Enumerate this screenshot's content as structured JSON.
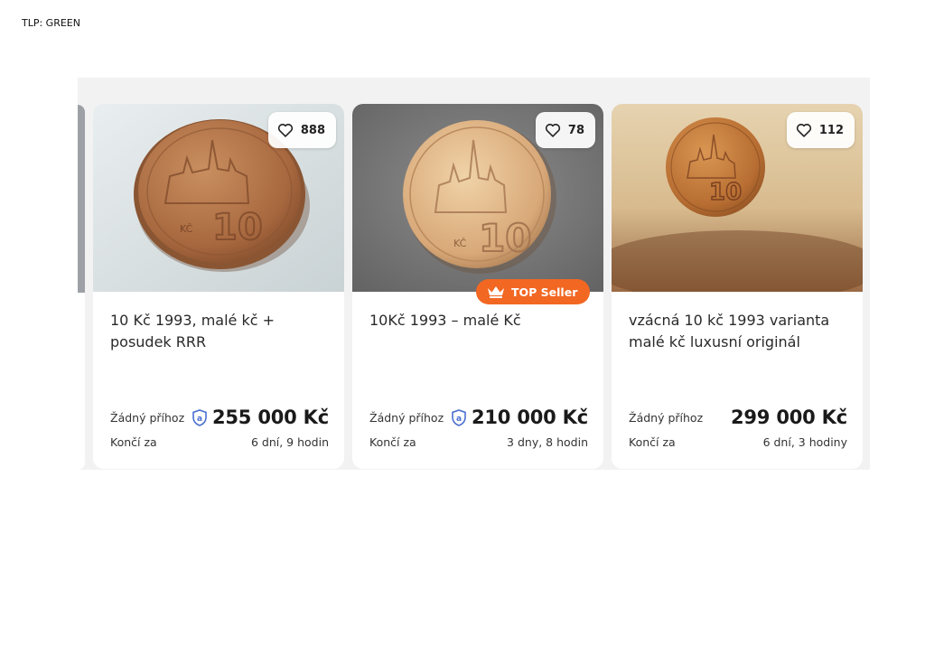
{
  "header": {
    "tlp": "TLP: GREEN"
  },
  "colors": {
    "accent": "#f26722",
    "verified": "#4a6fd1"
  },
  "listings": [
    {
      "favorites": "888",
      "title": "10 Kč 1993, malé kč + posudek RRR",
      "bid_label": "Žádný příhoz",
      "price": "255 000 Kč",
      "verified_seller": true,
      "ends_label": "Končí za",
      "ends_in": "6 dní, 9 hodin"
    },
    {
      "favorites": "78",
      "badge": "TOP Seller",
      "title": "10Kč 1993 – malé Kč",
      "bid_label": "Žádný příhoz",
      "price": "210 000 Kč",
      "verified_seller": true,
      "ends_label": "Končí za",
      "ends_in": "3 dny, 8 hodin"
    },
    {
      "favorites": "112",
      "title": "vzácná 10 kč 1993 varianta malé kč luxusní originál",
      "bid_label": "Žádný příhoz",
      "price": "299 000 Kč",
      "verified_seller": false,
      "ends_label": "Končí za",
      "ends_in": "6 dní, 3 hodiny"
    }
  ]
}
